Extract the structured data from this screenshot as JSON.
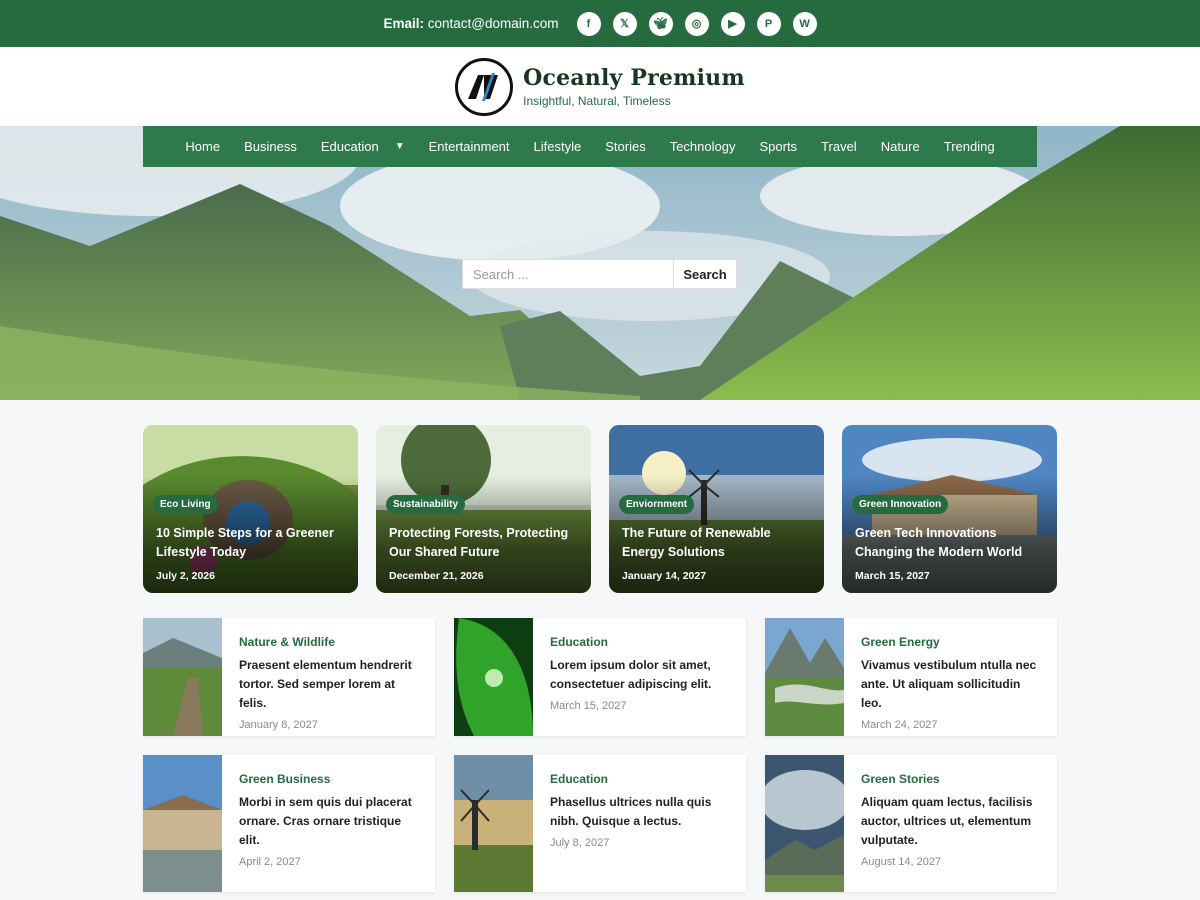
{
  "topbar": {
    "email_label": "Email:",
    "email": "contact@domain.com",
    "social": [
      "facebook-icon",
      "x-icon",
      "bluesky-icon",
      "instagram-icon",
      "youtube-icon",
      "pinterest-icon",
      "wordpress-icon"
    ]
  },
  "site": {
    "title": "Oceanly Premium",
    "tagline": "Insightful, Natural, Timeless"
  },
  "nav": {
    "items": [
      "Home",
      "Business",
      "Education",
      "Entertainment",
      "Lifestyle",
      "Stories",
      "Technology",
      "Sports",
      "Travel",
      "Nature",
      "Trending"
    ]
  },
  "search": {
    "placeholder": "Search ...",
    "button": "Search"
  },
  "featured": [
    {
      "category": "Eco Living",
      "title": "10 Simple Steps for a Greener Lifestyle Today",
      "date": "July 2, 2026"
    },
    {
      "category": "Sustainability",
      "title": "Protecting Forests, Protecting Our Shared Future",
      "date": "December 21, 2026"
    },
    {
      "category": "Enviornment",
      "title": "The Future of Renewable Energy Solutions",
      "date": "January 14, 2027"
    },
    {
      "category": "Green Innovation",
      "title": "Green Tech Innovations Changing the Modern World",
      "date": "March 15, 2027"
    }
  ],
  "posts": [
    {
      "category": "Nature & Wildlife",
      "title": "Praesent elementum hendrerit tortor. Sed semper lorem at felis.",
      "date": "January 8, 2027"
    },
    {
      "category": "Education",
      "title": "Lorem ipsum dolor sit amet, consectetuer adipiscing elit.",
      "date": "March 15, 2027"
    },
    {
      "category": "Green Energy",
      "title": "Vivamus vestibulum ntulla nec ante. Ut aliquam sollicitudin leo.",
      "date": "March 24, 2027"
    },
    {
      "category": "Green Business",
      "title": "Morbi in sem quis dui placerat ornare. Cras ornare tristique elit.",
      "date": "April 2, 2027"
    },
    {
      "category": "Education",
      "title": "Phasellus ultrices nulla quis nibh. Quisque a lectus.",
      "date": "July 8, 2027"
    },
    {
      "category": "Green Stories",
      "title": "Aliquam quam lectus, facilisis auctor, ultrices ut, elementum vulputate.",
      "date": "August 14, 2027"
    }
  ],
  "colors": {
    "primary": "#256b3f",
    "nav": "#2e7a4b"
  }
}
